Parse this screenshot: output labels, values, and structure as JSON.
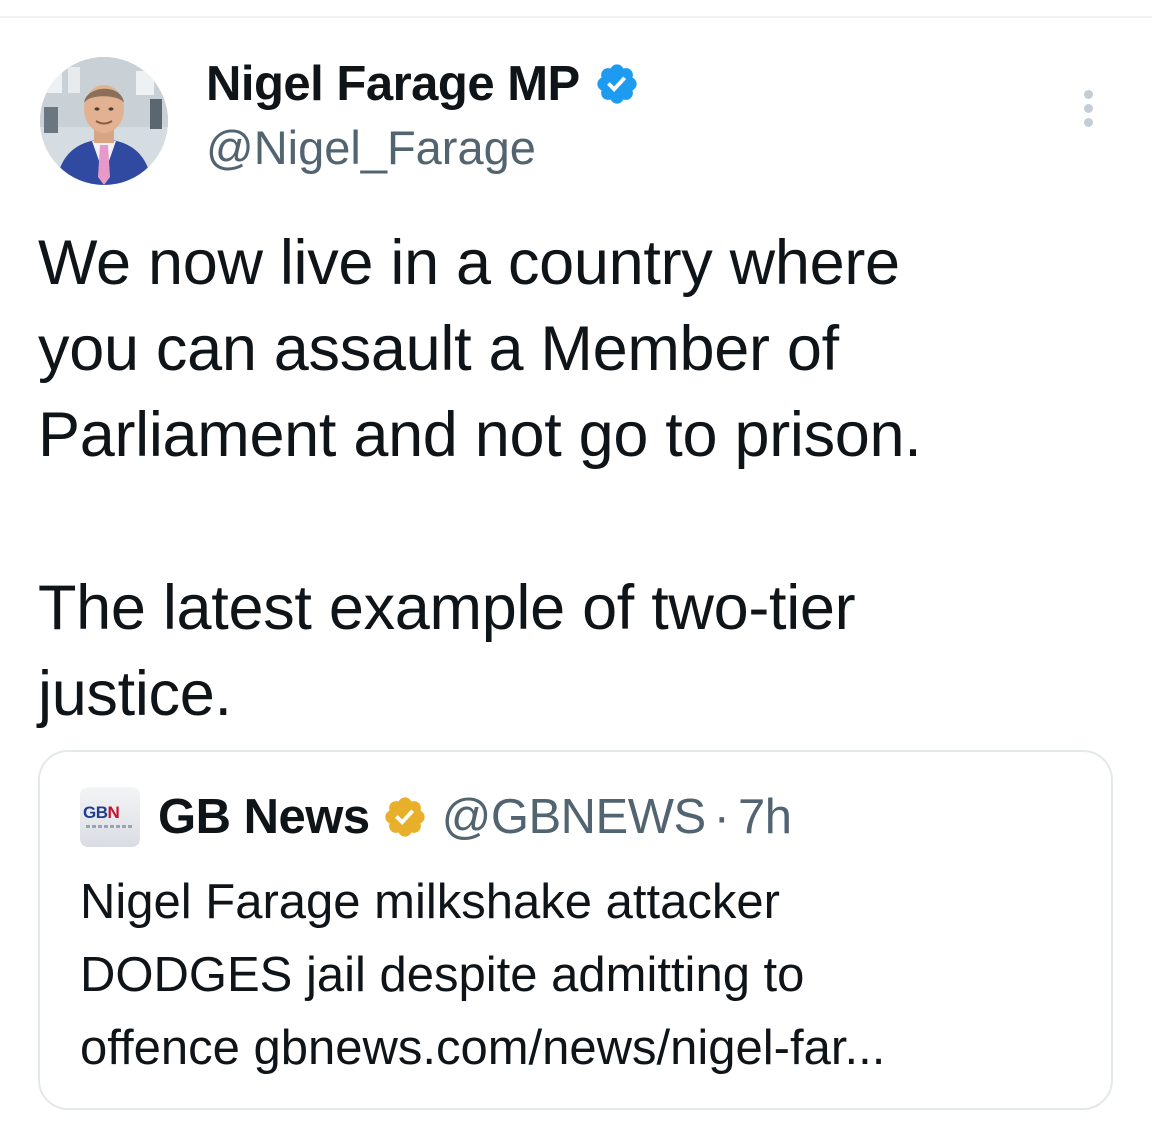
{
  "tweet": {
    "author": {
      "name": "Nigel Farage MP",
      "handle": "@Nigel_Farage",
      "verified_color": "#1d9bf0"
    },
    "more_icon": "more-vertical-icon",
    "paragraph_1": "We now live in a country where\nyou can assault a Member of\nParliament and not go to prison.",
    "paragraph_2": "The latest example of two-tier\njustice.",
    "quote": {
      "logo_text_blue": "GB",
      "logo_text_red": "N",
      "name": "GB News",
      "verified_color": "#e8b02a",
      "handle": "@GBNEWS",
      "separator": "·",
      "time": "7h",
      "text": "Nigel Farage milkshake attacker\nDODGES jail despite admitting to\noffence gbnews.com/news/nigel-far..."
    }
  },
  "colors": {
    "text_primary": "#0f1419",
    "text_secondary": "#536471",
    "border": "#e3e8eb"
  }
}
